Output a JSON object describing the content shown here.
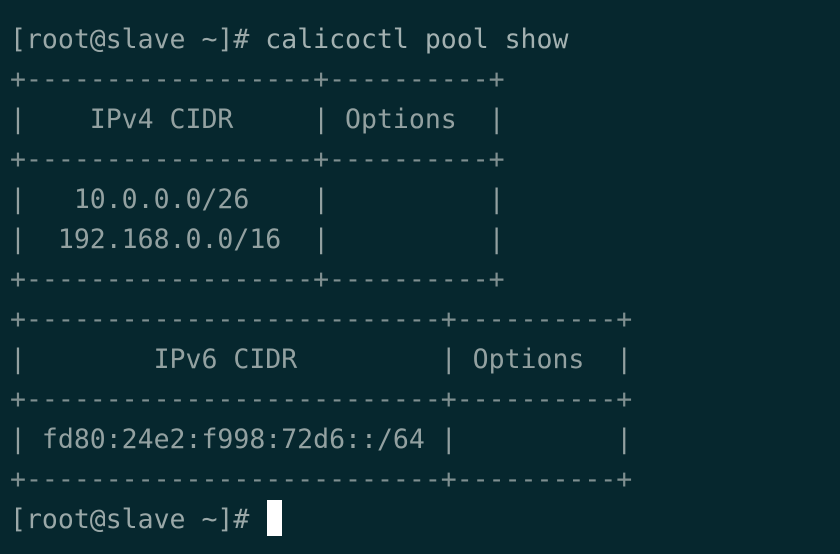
{
  "terminal": {
    "command_prompt": "[root@slave ~]# ",
    "command": "calicoctl pool show",
    "lines": [
      "+------------------+----------+",
      "|    IPv4 CIDR     | Options  |",
      "+------------------+----------+",
      "|   10.0.0.0/26    |          |",
      "|  192.168.0.0/16  |          |",
      "+------------------+----------+",
      "+--------------------------+----------+",
      "|        IPv6 CIDR         | Options  |",
      "+--------------------------+----------+",
      "| fd80:24e2:f998:72d6::/64 |          |",
      "+--------------------------+----------+"
    ],
    "final_prompt": "[root@slave ~]# "
  }
}
